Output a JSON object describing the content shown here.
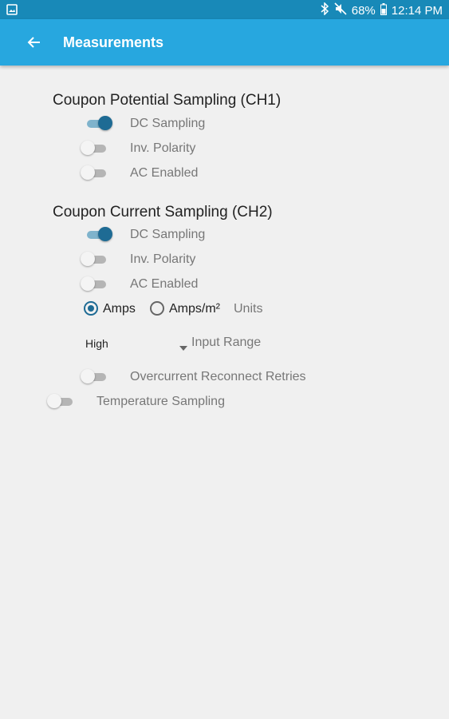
{
  "status_bar": {
    "battery": "68%",
    "time": "12:14 PM",
    "icons": [
      "gallery-icon",
      "bluetooth-icon",
      "mute-icon",
      "battery-icon"
    ]
  },
  "app_bar": {
    "title": "Measurements",
    "back_icon": "arrow-back-icon"
  },
  "ch1": {
    "title": "Coupon Potential Sampling (CH1)",
    "dc_sampling": {
      "label": "DC Sampling",
      "on": true
    },
    "inv_polarity": {
      "label": "Inv. Polarity",
      "on": false
    },
    "ac_enabled": {
      "label": "AC Enabled",
      "on": false
    }
  },
  "ch2": {
    "title": "Coupon Current Sampling (CH2)",
    "dc_sampling": {
      "label": "DC Sampling",
      "on": true
    },
    "inv_polarity": {
      "label": "Inv. Polarity",
      "on": false
    },
    "ac_enabled": {
      "label": "AC Enabled",
      "on": false
    },
    "units": {
      "options": [
        "Amps",
        "Amps/m²"
      ],
      "selected": "Amps",
      "label": "Units"
    },
    "input_range": {
      "value": "High",
      "label": "Input Range"
    },
    "overcurrent": {
      "label": "Overcurrent Reconnect Retries",
      "on": false
    }
  },
  "temperature": {
    "label": "Temperature Sampling",
    "on": false
  },
  "colors": {
    "status_bar": "#1889b8",
    "app_bar": "#27a7df",
    "accent": "#1e6b94",
    "background": "#f0f0f0"
  }
}
